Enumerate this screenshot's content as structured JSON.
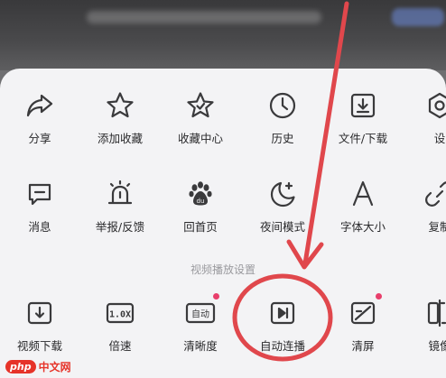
{
  "header": {
    "blurred_title": "",
    "blurred_button": ""
  },
  "menu": {
    "row1": [
      {
        "label": "分享",
        "icon": "share-icon"
      },
      {
        "label": "添加收藏",
        "icon": "star-icon"
      },
      {
        "label": "收藏中心",
        "icon": "star-badge-icon"
      },
      {
        "label": "历史",
        "icon": "clock-icon"
      },
      {
        "label": "文件/下载",
        "icon": "download-box-icon"
      },
      {
        "label": "设",
        "icon": "settings-icon"
      }
    ],
    "row2": [
      {
        "label": "消息",
        "icon": "message-icon"
      },
      {
        "label": "举报/反馈",
        "icon": "alarm-icon"
      },
      {
        "label": "回首页",
        "icon": "baidu-paw-icon"
      },
      {
        "label": "夜间模式",
        "icon": "moon-icon"
      },
      {
        "label": "字体大小",
        "icon": "font-a-icon"
      },
      {
        "label": "复制",
        "icon": "link-icon"
      }
    ],
    "video_section_title": "视频播放设置",
    "row3": [
      {
        "label": "视频下载",
        "icon": "video-download-icon"
      },
      {
        "label": "倍速",
        "icon": "speed-icon",
        "icon_text": "1.0X"
      },
      {
        "label": "清晰度",
        "icon": "clarity-icon",
        "icon_text": "自动",
        "badge": true
      },
      {
        "label": "自动连播",
        "icon": "autoplay-icon"
      },
      {
        "label": "清屏",
        "icon": "clear-screen-icon",
        "badge": true
      },
      {
        "label": "镜像",
        "icon": "mirror-icon"
      }
    ]
  },
  "watermark": {
    "logo": "php",
    "text": "中文网"
  },
  "colors": {
    "annotation": "#e0474c",
    "badge": "#e83e6b",
    "icon": "#3a3a3c"
  }
}
